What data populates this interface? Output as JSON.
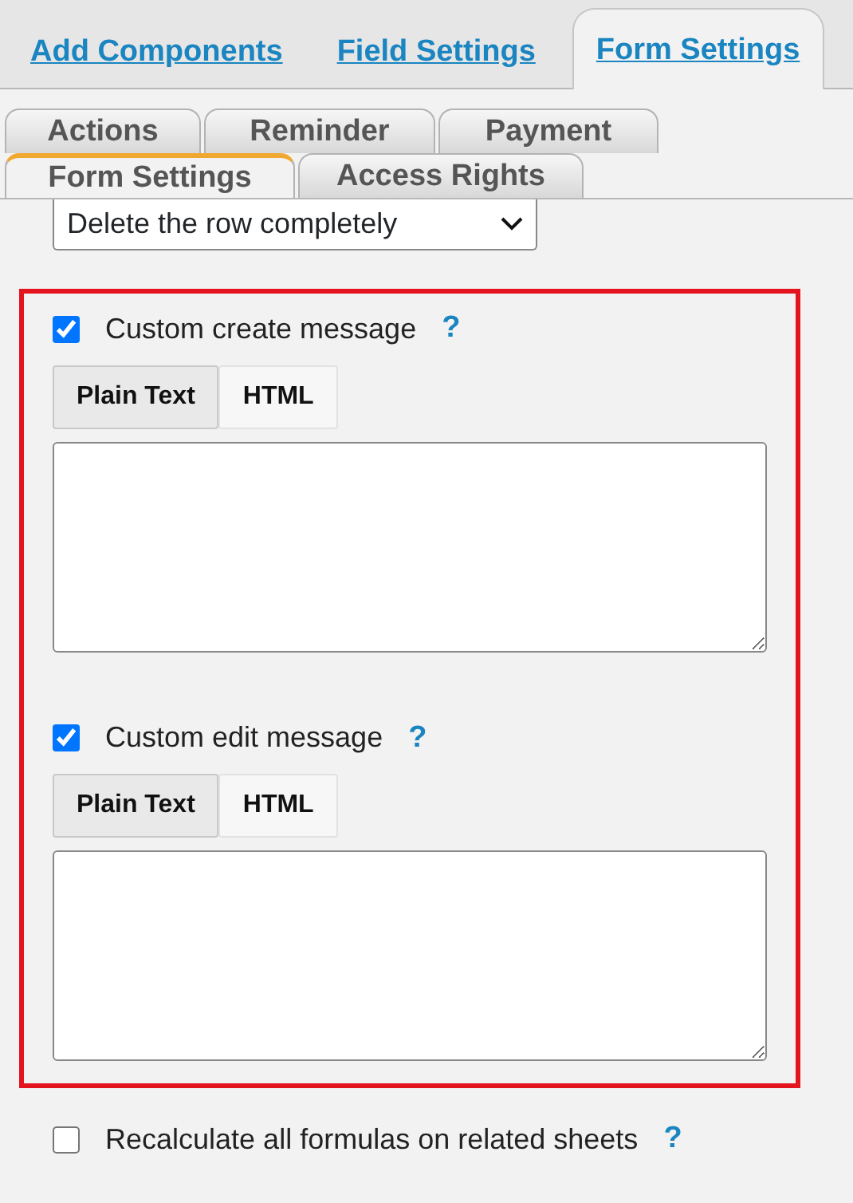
{
  "top_tabs": [
    {
      "label": "Add Components",
      "selected": false
    },
    {
      "label": "Field Settings",
      "selected": false
    },
    {
      "label": "Form Settings",
      "selected": true
    }
  ],
  "sub_tab_rows": [
    {
      "tabs": [
        {
          "label": "Actions",
          "selected": false
        },
        {
          "label": "Reminder",
          "selected": false
        },
        {
          "label": "Payment",
          "selected": false
        }
      ]
    },
    {
      "tabs": [
        {
          "label": "Form Settings",
          "selected": true
        },
        {
          "label": "Access Rights",
          "selected": false
        }
      ]
    }
  ],
  "delete_select": {
    "value": "Delete the row completely"
  },
  "message_section": {
    "highlighted": true,
    "messages": [
      {
        "label": "Custom create message",
        "checked": true,
        "help": "?",
        "formats": [
          {
            "label": "Plain Text",
            "selected": true
          },
          {
            "label": "HTML",
            "selected": false
          }
        ]
      },
      {
        "label": "Custom edit message",
        "checked": true,
        "help": "?",
        "formats": [
          {
            "label": "Plain Text",
            "selected": true
          },
          {
            "label": "HTML",
            "selected": false
          }
        ]
      }
    ]
  },
  "recalculate": {
    "label": "Recalculate all formulas on related sheets",
    "checked": false,
    "help": "?"
  }
}
